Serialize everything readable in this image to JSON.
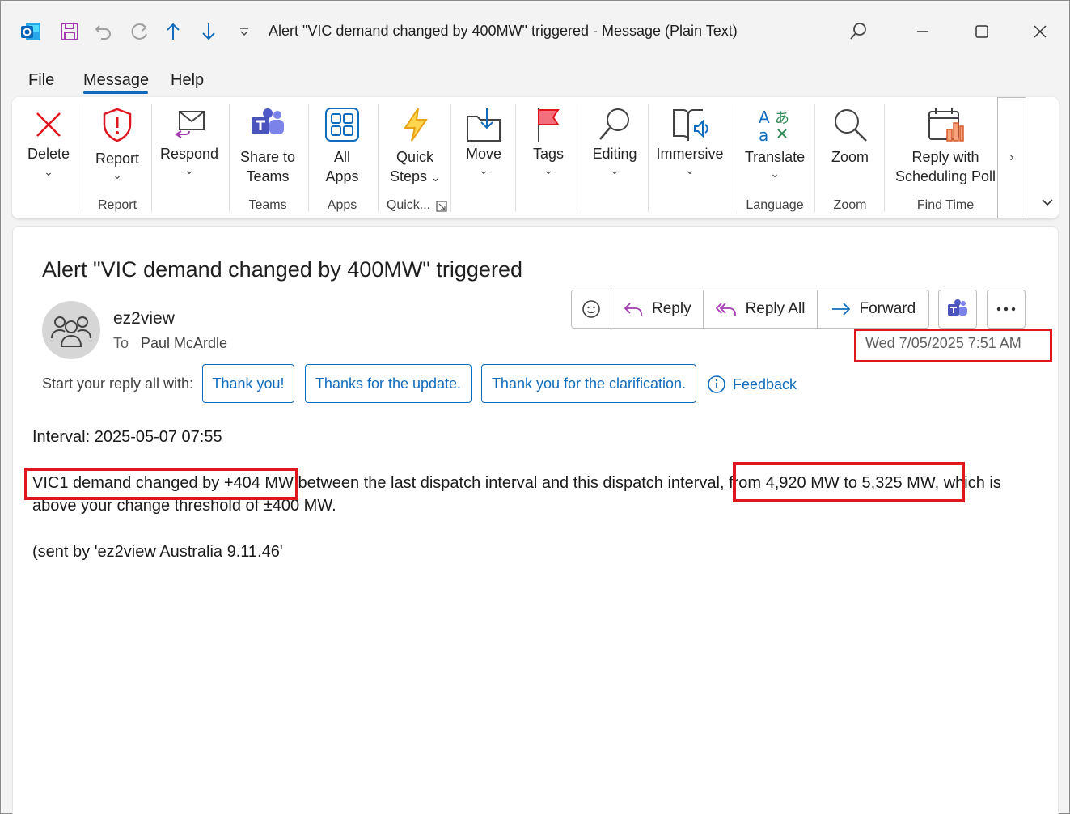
{
  "window": {
    "title": "Alert \"VIC demand changed by 400MW\" triggered  -  Message (Plain Text)"
  },
  "menu": {
    "tabs": [
      "File",
      "Message",
      "Help"
    ],
    "active": "Message"
  },
  "ribbon": {
    "delete": "Delete",
    "report": "Report",
    "respond": "Respond",
    "share_teams_1": "Share to",
    "share_teams_2": "Teams",
    "all_apps_1": "All",
    "all_apps_2": "Apps",
    "quick_steps_1": "Quick",
    "quick_steps_2": "Steps",
    "move": "Move",
    "tags": "Tags",
    "editing": "Editing",
    "immersive": "Immersive",
    "translate": "Translate",
    "zoom": "Zoom",
    "reply_poll_1": "Reply with",
    "reply_poll_2": "Scheduling Poll",
    "groups": {
      "report": "Report",
      "teams": "Teams",
      "apps": "Apps",
      "quick": "Quick...",
      "language": "Language",
      "zoom": "Zoom",
      "find_time": "Find Time"
    }
  },
  "message": {
    "subject": "Alert \"VIC demand changed by 400MW\" triggered",
    "sender": "ez2view",
    "to_label": "To",
    "to_name": "Paul McArdle",
    "date": "Wed 7/05/2025 7:51 AM",
    "actions": {
      "reply": "Reply",
      "reply_all": "Reply All",
      "forward": "Forward"
    },
    "quick_reply_label": "Start your reply all with:",
    "suggestions": [
      "Thank you!",
      "Thanks for the update.",
      "Thank you for the clarification."
    ],
    "feedback": "Feedback",
    "body": {
      "interval": "Interval: 2025-05-07 07:55",
      "line1_a": "VIC1 demand changed by +404 MW",
      "line1_b": " between the last dispatch interval and this dispatch interval, ",
      "line1_c": "from 4,920 MW to 5,325 MW,",
      "line1_d": " which is",
      "line2": "above your change threshold of ±400 MW.",
      "sent_by": "(sent by 'ez2view Australia 9.11.46'"
    }
  },
  "colors": {
    "accent": "#0f6cbd",
    "highlight": "#e0161f"
  }
}
